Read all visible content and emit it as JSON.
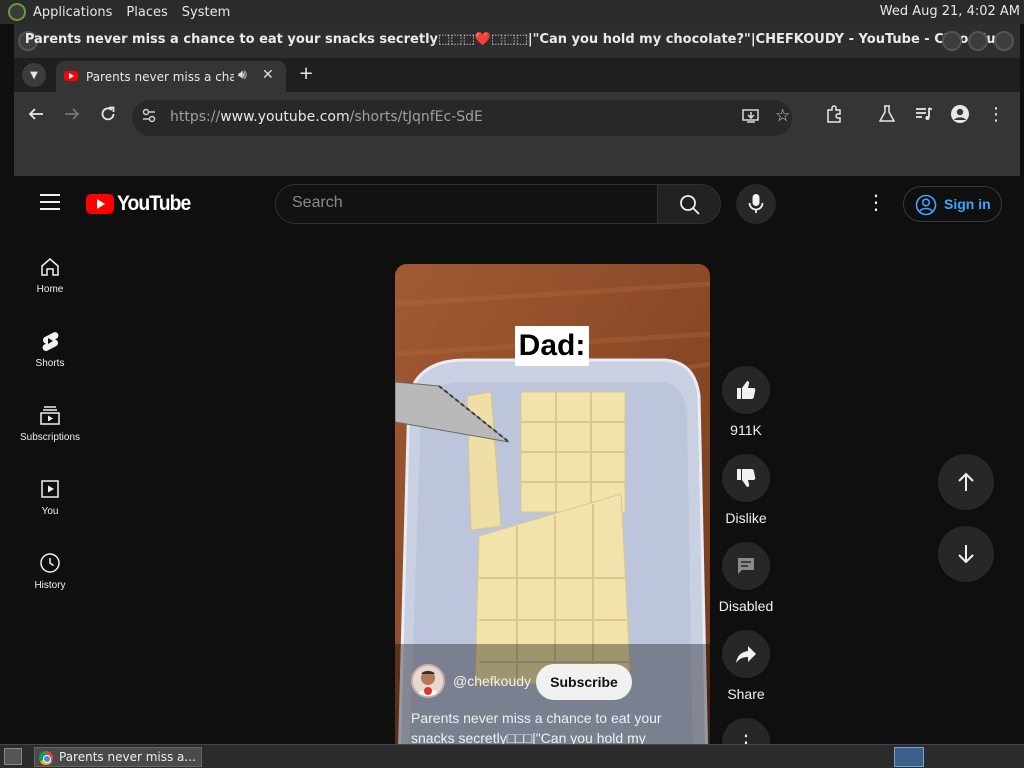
{
  "desktop": {
    "menu": [
      "Applications",
      "Places",
      "System"
    ],
    "clock": "Wed Aug 21,  4:02 AM"
  },
  "window": {
    "title": "Parents never miss a chance to eat your snacks secretly⬚⬚⬚❤️⬚⬚⬚|\"Can you hold my chocolate?\"|CHEFKOUDY - YouTube - Chromium"
  },
  "browser": {
    "tab_title": "Parents never miss a chance",
    "url_prefix": "https://",
    "url_host": "www.youtube.com",
    "url_path": "/shorts/tJqnfEc-SdE"
  },
  "youtube": {
    "logo_text": "YouTube",
    "search_placeholder": "Search",
    "sign_in": "Sign in",
    "guide": [
      {
        "label": "Home",
        "icon": "home-icon"
      },
      {
        "label": "Shorts",
        "icon": "shorts-icon"
      },
      {
        "label": "Subscriptions",
        "icon": "subscriptions-icon"
      },
      {
        "label": "You",
        "icon": "you-icon"
      },
      {
        "label": "History",
        "icon": "history-icon"
      }
    ],
    "short": {
      "overlay_text": "Dad:",
      "channel": "@chefkoudy",
      "subscribe": "Subscribe",
      "caption": "Parents never miss a chance to eat your snacks secretly□□□|\"Can you hold my chocolate?\"|CHEFKOUDY"
    },
    "actions": {
      "likes": "911K",
      "dislike": "Dislike",
      "comments": "Disabled",
      "share": "Share"
    }
  },
  "taskbar": {
    "item": "Parents never miss a..."
  }
}
